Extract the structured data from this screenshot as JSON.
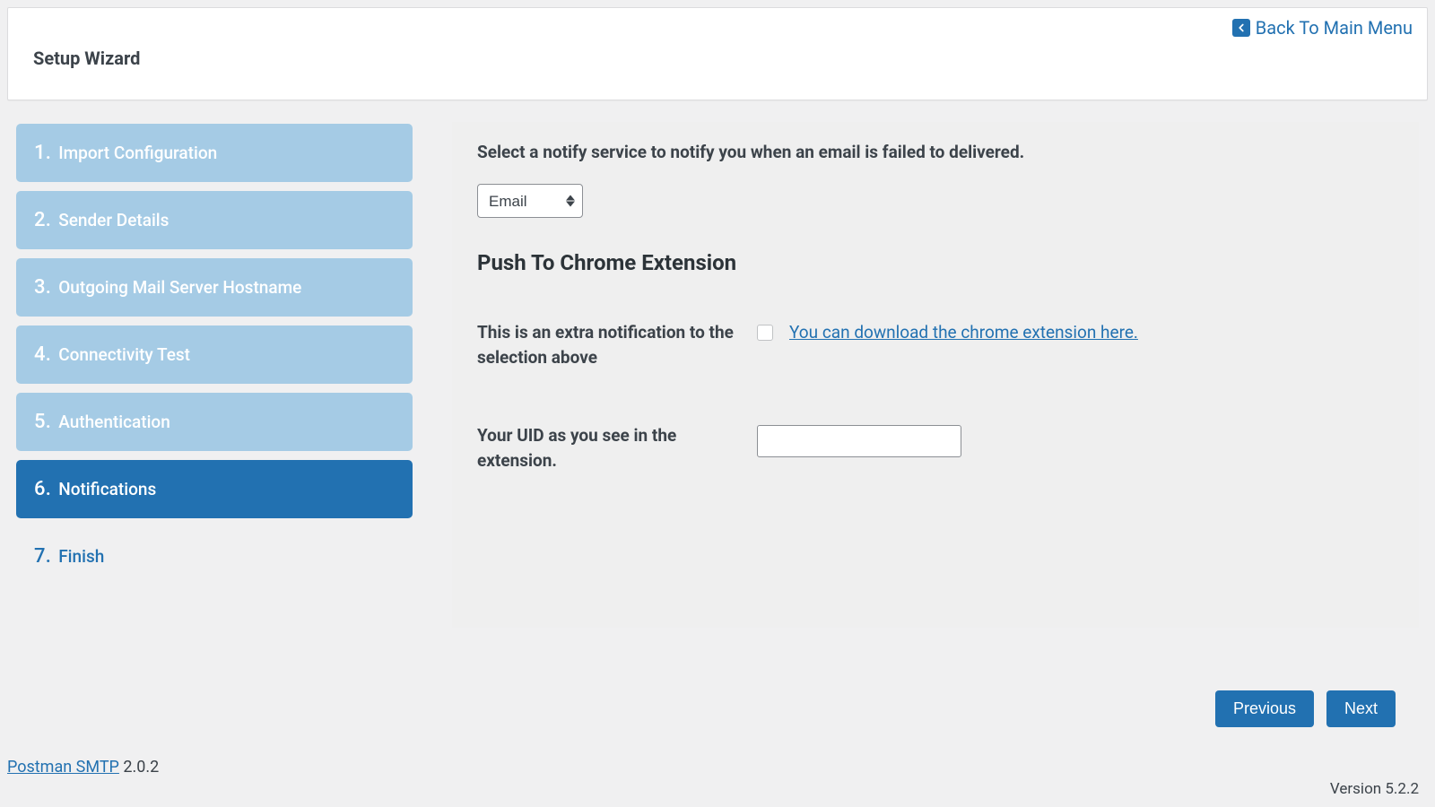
{
  "header": {
    "title": "Setup Wizard",
    "back_label": "Back To Main Menu"
  },
  "sidebar": {
    "items": [
      {
        "num": "1.",
        "label": "Import Configuration",
        "state": "done"
      },
      {
        "num": "2.",
        "label": "Sender Details",
        "state": "done"
      },
      {
        "num": "3.",
        "label": "Outgoing Mail Server Hostname",
        "state": "done"
      },
      {
        "num": "4.",
        "label": "Connectivity Test",
        "state": "done"
      },
      {
        "num": "5.",
        "label": "Authentication",
        "state": "done"
      },
      {
        "num": "6.",
        "label": "Notifications",
        "state": "active"
      },
      {
        "num": "7.",
        "label": "Finish",
        "state": "pending"
      }
    ]
  },
  "main": {
    "intro": "Select a notify service to notify you when an email is failed to delivered.",
    "notify_select": {
      "selected": "Email"
    },
    "section_heading": "Push To Chrome Extension",
    "rows": {
      "extra_notification": {
        "label": "This is an extra notification to the selection above",
        "link_text": "You can download the chrome extension here."
      },
      "uid": {
        "label": "Your UID as you see in the extension.",
        "value": ""
      }
    }
  },
  "buttons": {
    "previous": "Previous",
    "next": "Next"
  },
  "footer": {
    "plugin_link": "Postman SMTP",
    "plugin_version": "2.0.2",
    "wp_version": "Version 5.2.2"
  }
}
